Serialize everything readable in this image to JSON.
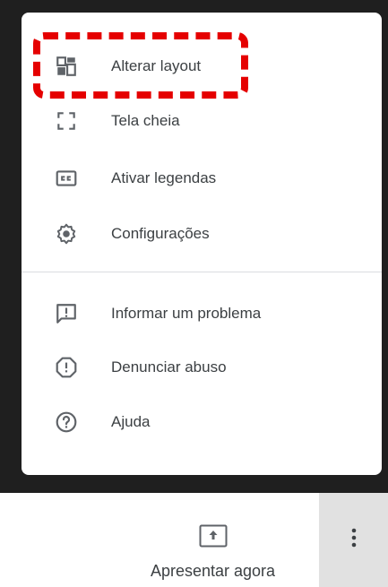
{
  "menu": {
    "items": [
      {
        "label": "Alterar layout",
        "icon": "change-layout-icon"
      },
      {
        "label": "Tela cheia",
        "icon": "fullscreen-icon"
      },
      {
        "label": "Ativar legendas",
        "icon": "captions-icon"
      },
      {
        "label": "Configurações",
        "icon": "settings-gear-icon"
      },
      {
        "label": "Informar um problema",
        "icon": "report-problem-icon"
      },
      {
        "label": "Denunciar abuso",
        "icon": "report-abuse-icon"
      },
      {
        "label": "Ajuda",
        "icon": "help-icon"
      }
    ]
  },
  "bottom_bar": {
    "present_label": "Apresentar agora",
    "present_icon": "present-screen-icon",
    "more_icon": "more-vertical-icon"
  },
  "annotation": {
    "highlight_color": "#e50000"
  }
}
